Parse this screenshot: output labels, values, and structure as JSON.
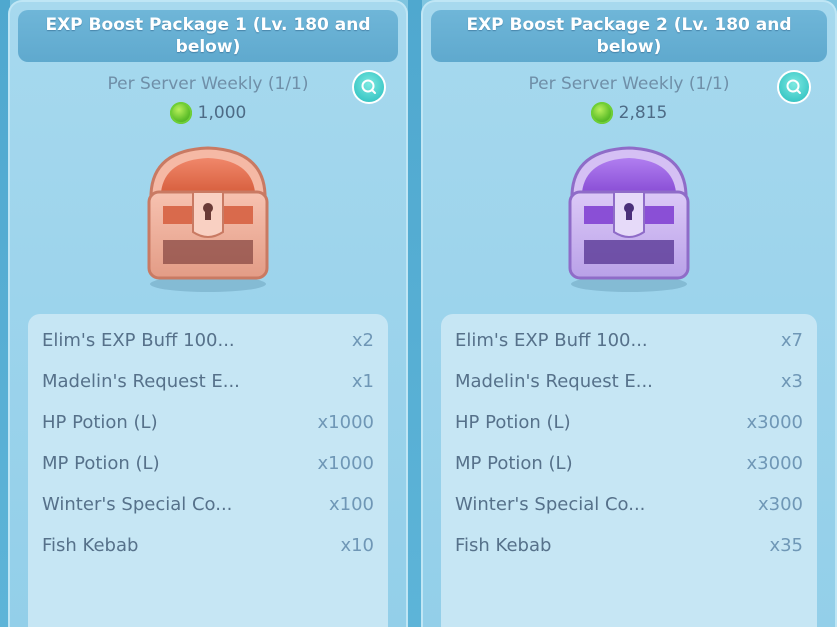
{
  "packages": [
    {
      "title": "EXP Boost Package 1 (Lv. 180 and below)",
      "limit": "Per Server Weekly (1/1)",
      "price": "1,000",
      "chest_color": "orange",
      "items": [
        {
          "name": "Elim's EXP Buff 100...",
          "qty": "x2"
        },
        {
          "name": "Madelin's Request E...",
          "qty": "x1"
        },
        {
          "name": "HP Potion (L)",
          "qty": "x1000"
        },
        {
          "name": "MP Potion (L)",
          "qty": "x1000"
        },
        {
          "name": "Winter's Special Co...",
          "qty": "x100"
        },
        {
          "name": "Fish Kebab",
          "qty": "x10"
        }
      ]
    },
    {
      "title": "EXP Boost Package 2 (Lv. 180 and below)",
      "limit": "Per Server Weekly (1/1)",
      "price": "2,815",
      "chest_color": "purple",
      "items": [
        {
          "name": "Elim's EXP Buff 100...",
          "qty": "x7"
        },
        {
          "name": "Madelin's Request E...",
          "qty": "x3"
        },
        {
          "name": "HP Potion (L)",
          "qty": "x3000"
        },
        {
          "name": "MP Potion (L)",
          "qty": "x3000"
        },
        {
          "name": "Winter's Special Co...",
          "qty": "x300"
        },
        {
          "name": "Fish Kebab",
          "qty": "x35"
        }
      ]
    }
  ],
  "icons": {
    "search": "magnifier-icon",
    "currency": "green-coin-icon",
    "chest": "treasure-chest-icon"
  },
  "colors": {
    "accent_teal": "#3fc9c7",
    "title_bar": "#5fa9ce",
    "chest_orange": "#e8775a",
    "chest_purple": "#9a5bd8"
  }
}
